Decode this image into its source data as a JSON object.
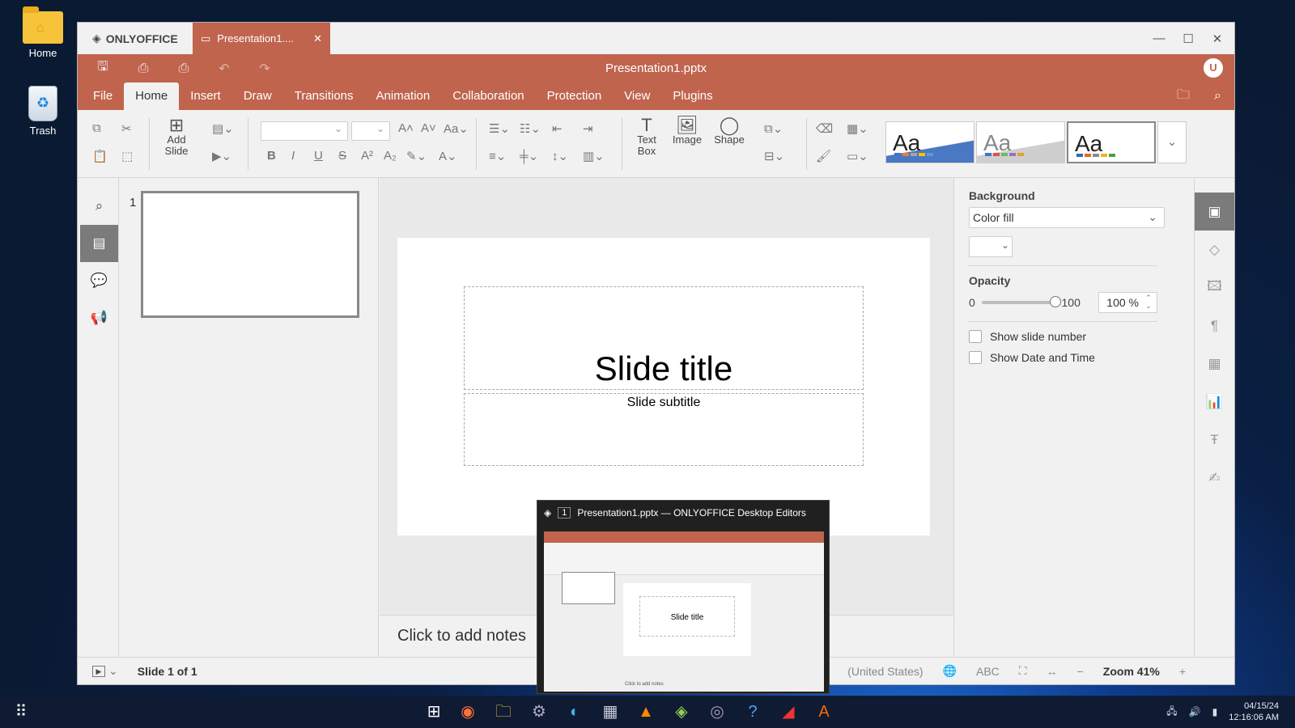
{
  "desktop": {
    "icons": [
      {
        "label": "Home",
        "icon": "home-folder-icon"
      },
      {
        "label": "Trash",
        "icon": "trash-icon"
      }
    ]
  },
  "window": {
    "app_name": "ONLYOFFICE",
    "tab_title": "Presentation1....",
    "doc_title": "Presentation1.pptx",
    "avatar": "U",
    "accent": "#c0644e"
  },
  "menu": {
    "items": [
      "File",
      "Home",
      "Insert",
      "Draw",
      "Transitions",
      "Animation",
      "Collaboration",
      "Protection",
      "View",
      "Plugins"
    ],
    "active": "Home"
  },
  "toolbar": {
    "add_slide_line1": "Add",
    "add_slide_line2": "Slide",
    "text_box_line1": "Text",
    "text_box_line2": "Box",
    "image": "Image",
    "shape": "Shape",
    "theme_label": "Aa"
  },
  "thumbnails": {
    "number": "1"
  },
  "slide": {
    "title": "Slide title",
    "subtitle": "Slide subtitle",
    "notes_placeholder": "Click to add notes"
  },
  "right_panel": {
    "background_heading": "Background",
    "fill_type": "Color fill",
    "opacity_heading": "Opacity",
    "opacity_min": "0",
    "opacity_max": "100",
    "opacity_value": "100 %",
    "opacity_level": 1.0,
    "show_slide_number": "Show slide number",
    "show_date_time": "Show Date and Time"
  },
  "status": {
    "slide_count": "Slide 1 of 1",
    "language": "(United States)",
    "zoom": "Zoom 41%"
  },
  "taskbar_preview": {
    "badge": "1",
    "title": "Presentation1.pptx — ONLYOFFICE Desktop Editors",
    "mini_slide_title": "Slide title",
    "mini_notes": "Click to add notes"
  },
  "clock": {
    "date": "04/15/24",
    "time": "12:16:06 AM"
  }
}
